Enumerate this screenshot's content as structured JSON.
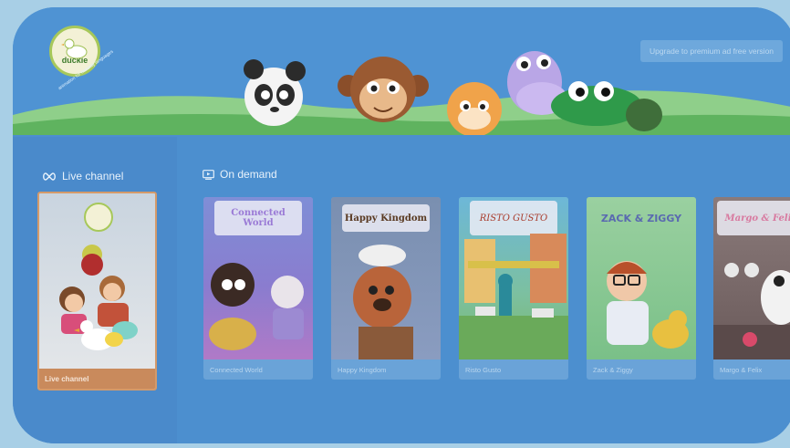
{
  "header": {
    "logo_word": "duckie",
    "logo_tagline": "animation for minority languages",
    "upgrade_label": "Upgrade to premium ad free version"
  },
  "live": {
    "section_label": "Live channel",
    "card_label": "Live channel"
  },
  "on_demand": {
    "section_label": "On demand",
    "items": [
      {
        "title": "Connected World",
        "plate": "Connected World"
      },
      {
        "title": "Happy Kingdom",
        "plate": "Happy Kingdom"
      },
      {
        "title": "Risto Gusto",
        "plate": "RISTO GUSTO"
      },
      {
        "title": "Zack & Ziggy",
        "plate": "ZACK & ZIGGY"
      },
      {
        "title": "Margo & Felix",
        "plate": "Margo & Felix"
      }
    ]
  },
  "icons": {
    "live": "infinity-icon",
    "on_demand": "play-screen-icon"
  },
  "colors": {
    "frame": "#4c8fcf",
    "live_accent": "#c98a5c"
  }
}
